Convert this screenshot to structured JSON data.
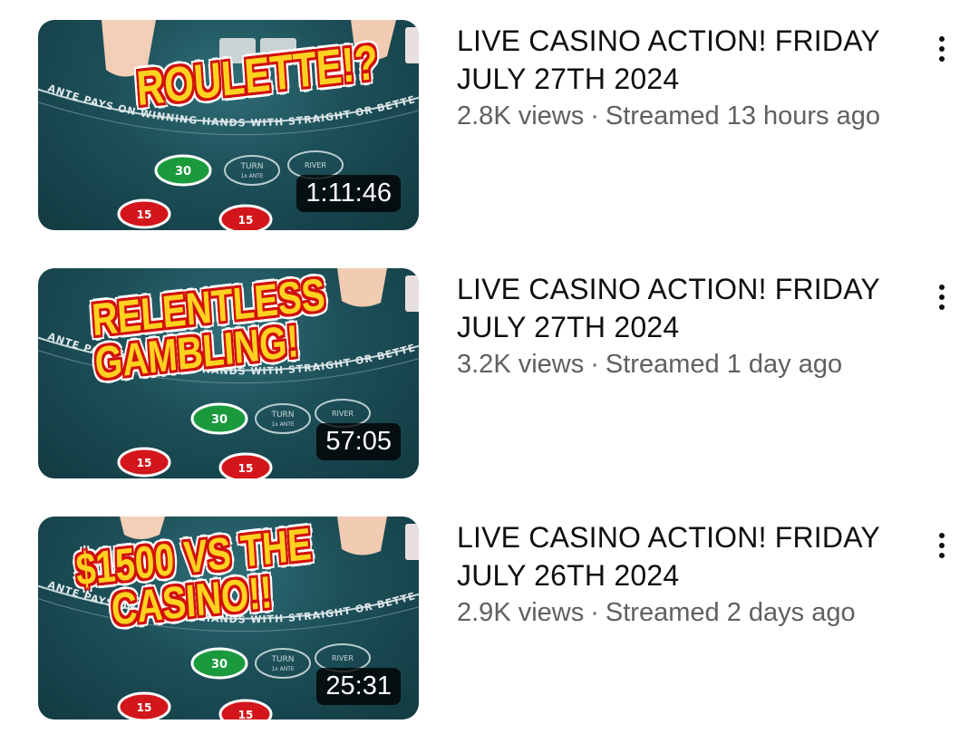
{
  "videos": [
    {
      "title_line1": "LIVE CASINO ACTION! FRIDAY",
      "title_line2": "JULY 27TH 2024",
      "views": "2.8K views",
      "separator": "·",
      "streamed": "Streamed 13 hours ago",
      "duration": "1:11:46",
      "thumb_text_lines": [
        "ROULETTE!?"
      ],
      "menu_icon": "more-vert-icon"
    },
    {
      "title_line1": "LIVE CASINO ACTION! FRIDAY",
      "title_line2": "JULY 27TH 2024",
      "views": "3.2K views",
      "separator": "·",
      "streamed": "Streamed 1 day ago",
      "duration": "57:05",
      "thumb_text_lines": [
        "RELENTLESS",
        "GAMBLING!"
      ],
      "menu_icon": "more-vert-icon"
    },
    {
      "title_line1": "LIVE CASINO ACTION! FRIDAY",
      "title_line2": "JULY 26TH 2024",
      "views": "2.9K views",
      "separator": "·",
      "streamed": "Streamed 2 days ago",
      "duration": "25:31",
      "thumb_text_lines": [
        "$1500 VS THE",
        "CASINO!!"
      ],
      "menu_icon": "more-vert-icon"
    }
  ],
  "felt": {
    "arc_text": "ANTE PAYS ON WINNING HANDS WITH STRAIGHT OR BETTER",
    "turn_label": "TURN",
    "river_label": "RIVER",
    "ante_label": "1x ANTE",
    "chip_green_value": "30",
    "chip_red_value": "15"
  },
  "colors": {
    "felt": "#1d4f58",
    "thumb_text_fill": "#ffd21f",
    "thumb_text_outline": "#d1100c",
    "meta_gray": "#606060"
  }
}
